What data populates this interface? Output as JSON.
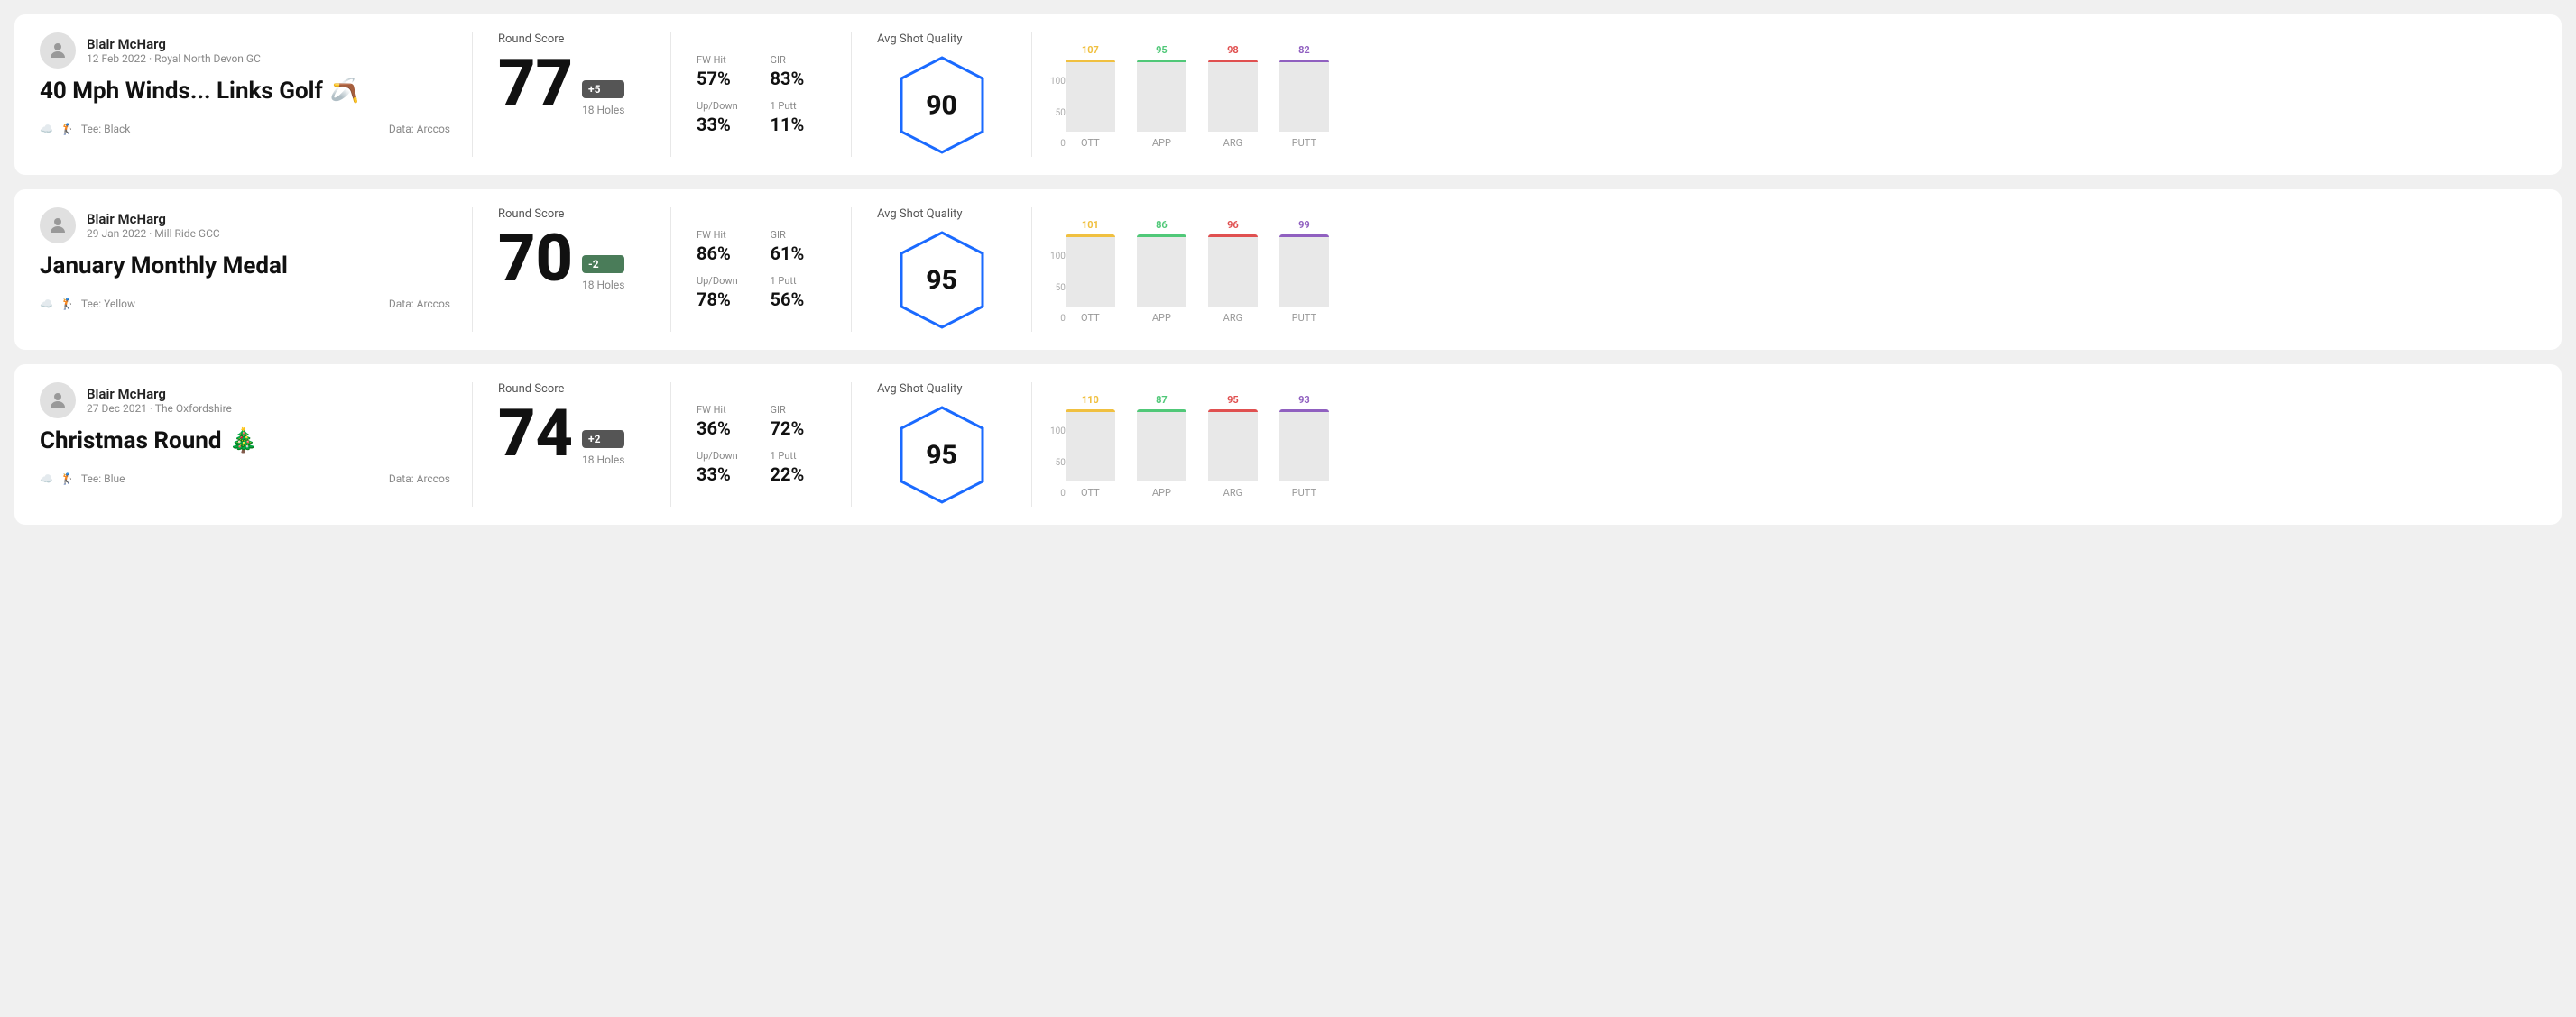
{
  "rounds": [
    {
      "id": "round1",
      "player_name": "Blair McHarg",
      "date": "12 Feb 2022 · Royal North Devon GC",
      "title": "40 Mph Winds... Links Golf",
      "title_emoji": "🪃",
      "tee": "Black",
      "data_source": "Data: Arccos",
      "score": "77",
      "score_modifier": "+5",
      "holes": "18 Holes",
      "fw_hit_label": "FW Hit",
      "fw_hit_value": "57%",
      "gir_label": "GIR",
      "gir_value": "83%",
      "updown_label": "Up/Down",
      "updown_value": "33%",
      "oneputt_label": "1 Putt",
      "oneputt_value": "11%",
      "avg_shot_quality_label": "Avg Shot Quality",
      "avg_shot_quality_score": "90",
      "chart": {
        "bars": [
          {
            "label": "OTT",
            "value": 107,
            "color": "#f0c040"
          },
          {
            "label": "APP",
            "value": 95,
            "color": "#50c878"
          },
          {
            "label": "ARG",
            "value": 98,
            "color": "#e05050"
          },
          {
            "label": "PUTT",
            "value": 82,
            "color": "#9060c0"
          }
        ],
        "y_labels": [
          "100",
          "50",
          "0"
        ]
      }
    },
    {
      "id": "round2",
      "player_name": "Blair McHarg",
      "date": "29 Jan 2022 · Mill Ride GCC",
      "title": "January Monthly Medal",
      "title_emoji": "",
      "tee": "Yellow",
      "data_source": "Data: Arccos",
      "score": "70",
      "score_modifier": "-2",
      "holes": "18 Holes",
      "fw_hit_label": "FW Hit",
      "fw_hit_value": "86%",
      "gir_label": "GIR",
      "gir_value": "61%",
      "updown_label": "Up/Down",
      "updown_value": "78%",
      "oneputt_label": "1 Putt",
      "oneputt_value": "56%",
      "avg_shot_quality_label": "Avg Shot Quality",
      "avg_shot_quality_score": "95",
      "chart": {
        "bars": [
          {
            "label": "OTT",
            "value": 101,
            "color": "#f0c040"
          },
          {
            "label": "APP",
            "value": 86,
            "color": "#50c878"
          },
          {
            "label": "ARG",
            "value": 96,
            "color": "#e05050"
          },
          {
            "label": "PUTT",
            "value": 99,
            "color": "#9060c0"
          }
        ],
        "y_labels": [
          "100",
          "50",
          "0"
        ]
      }
    },
    {
      "id": "round3",
      "player_name": "Blair McHarg",
      "date": "27 Dec 2021 · The Oxfordshire",
      "title": "Christmas Round",
      "title_emoji": "🎄",
      "tee": "Blue",
      "data_source": "Data: Arccos",
      "score": "74",
      "score_modifier": "+2",
      "holes": "18 Holes",
      "fw_hit_label": "FW Hit",
      "fw_hit_value": "36%",
      "gir_label": "GIR",
      "gir_value": "72%",
      "updown_label": "Up/Down",
      "updown_value": "33%",
      "oneputt_label": "1 Putt",
      "oneputt_value": "22%",
      "avg_shot_quality_label": "Avg Shot Quality",
      "avg_shot_quality_score": "95",
      "chart": {
        "bars": [
          {
            "label": "OTT",
            "value": 110,
            "color": "#f0c040"
          },
          {
            "label": "APP",
            "value": 87,
            "color": "#50c878"
          },
          {
            "label": "ARG",
            "value": 95,
            "color": "#e05050"
          },
          {
            "label": "PUTT",
            "value": 93,
            "color": "#9060c0"
          }
        ],
        "y_labels": [
          "100",
          "50",
          "0"
        ]
      }
    }
  ]
}
